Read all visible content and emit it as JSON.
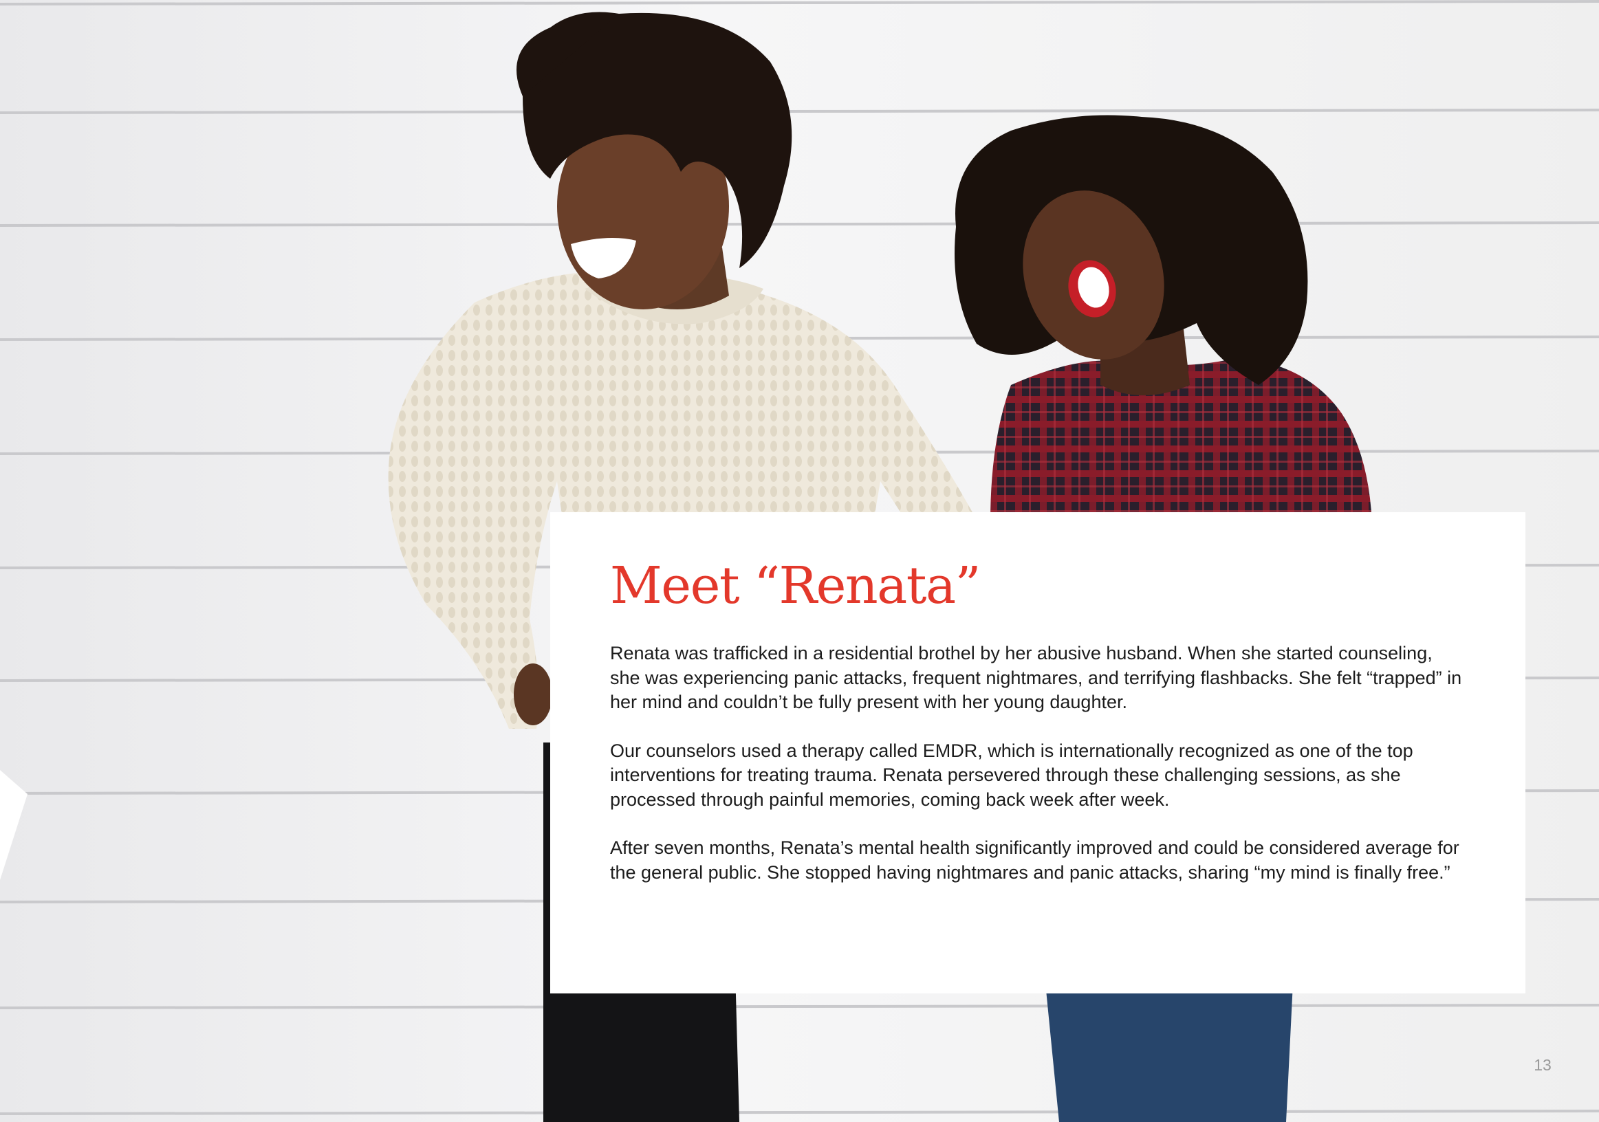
{
  "page": {
    "number": "13"
  },
  "card": {
    "title": "Meet “Renata”",
    "paragraphs": [
      "Renata was trafficked in a residential brothel by her abusive husband. When she started counseling, she was experiencing panic attacks, frequent nightmares, and terrifying flashbacks. She felt “trapped” in her mind and couldn’t be fully present with her young daughter.",
      "Our counselors used a therapy called EMDR, which is internationally recognized as one of the top interventions for treating trauma. Renata persevered through these challenging sessions, as she processed through painful memories, coming back week after week.",
      "After seven months, Renata’s mental health significantly improved and could be considered average for the general public. She stopped having nightmares and panic attacks, sharing “my mind is finally free.”"
    ]
  },
  "colors": {
    "accent": "#e3382b",
    "body_text": "#1c1c1c",
    "wall": "#f1f1f2",
    "card_background": "#ffffff"
  }
}
